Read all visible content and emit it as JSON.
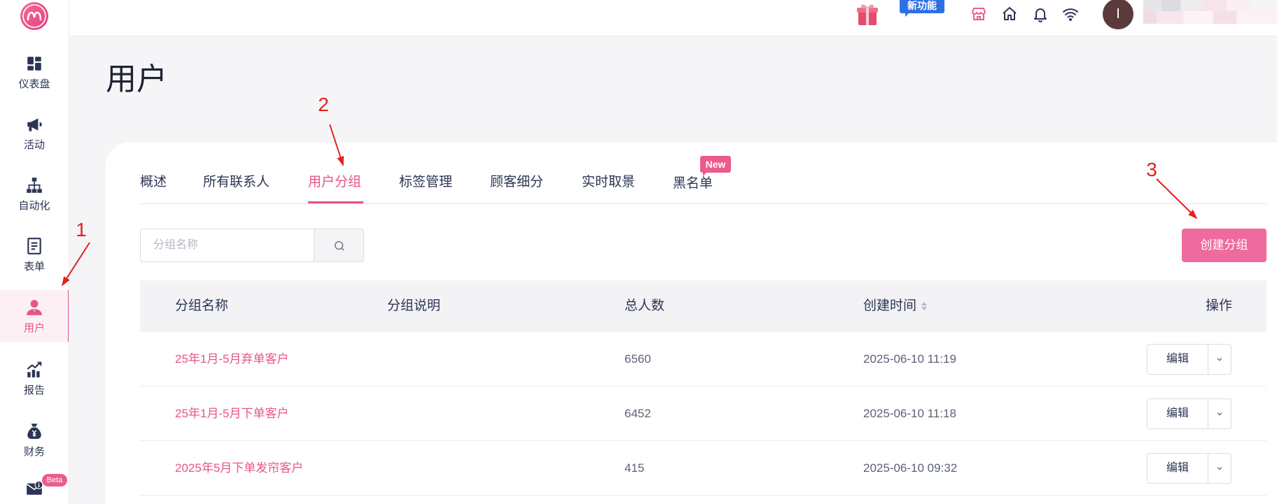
{
  "colors": {
    "primary": "#e8548a",
    "button": "#ef6b9e",
    "text": "#2b3553",
    "muted_text": "#5a6275",
    "new_feature_badge": "#2f6fe4",
    "annotation": "#e3211f"
  },
  "sidebar": {
    "logo_icon": "brand-logo-icon",
    "items": [
      {
        "label": "仪表盘",
        "icon": "dashboard-icon"
      },
      {
        "label": "活动",
        "icon": "megaphone-icon"
      },
      {
        "label": "自动化",
        "icon": "flowchart-icon"
      },
      {
        "label": "表单",
        "icon": "form-icon"
      },
      {
        "label": "用户",
        "icon": "user-icon",
        "active": true
      },
      {
        "label": "报告",
        "icon": "report-chart-icon"
      },
      {
        "label": "财务",
        "icon": "money-bag-icon"
      },
      {
        "icon": "mail-info-icon",
        "badge": "Beta"
      }
    ]
  },
  "header": {
    "icons": [
      "gift-icon",
      "store-icon",
      "home-icon",
      "bell-icon",
      "wifi-icon"
    ],
    "new_feature_badge": "新功能",
    "avatar_initial": "I"
  },
  "page": {
    "title": "用户"
  },
  "tabs": {
    "items": [
      {
        "label": "概述"
      },
      {
        "label": "所有联系人"
      },
      {
        "label": "用户分组",
        "active": true
      },
      {
        "label": "标签管理"
      },
      {
        "label": "顾客细分"
      },
      {
        "label": "实时取景"
      },
      {
        "label": "黑名单",
        "badge": "New"
      }
    ]
  },
  "search": {
    "placeholder": "分组名称",
    "icon": "search-icon"
  },
  "create_button": {
    "label": "创建分组"
  },
  "table": {
    "columns": [
      "分组名称",
      "分组说明",
      "总人数",
      "创建时间",
      "操作"
    ],
    "sort_icon": "sort-icon",
    "rows": [
      {
        "name": "25年1月-5月弃单客户",
        "total": "6560",
        "created": "2025-06-10 11:19",
        "action": "编辑"
      },
      {
        "name": "25年1月-5月下单客户",
        "total": "6452",
        "created": "2025-06-10 11:18",
        "action": "编辑"
      },
      {
        "name": "2025年5月下单发帘客户",
        "total": "415",
        "created": "2025-06-10 09:32",
        "action": "编辑"
      }
    ]
  },
  "annotations": [
    "1",
    "2",
    "3"
  ]
}
